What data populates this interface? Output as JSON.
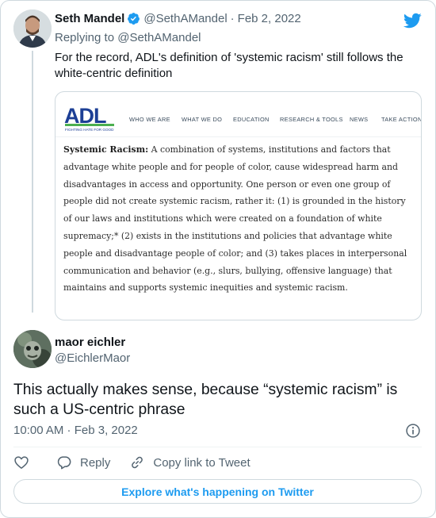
{
  "parent_tweet": {
    "author_name": "Seth Mandel",
    "handle": "@SethAMandel",
    "date": "Feb 2, 2022",
    "replying_to": "Replying to @SethAMandel",
    "text": "For the record, ADL's definition of 'systemic racism' still follows the white-centric definition"
  },
  "embedded_image": {
    "logo_text": "ADL",
    "logo_tagline": "FIGHTING HATE FOR GOOD",
    "nav": [
      "WHO WE ARE",
      "WHAT WE DO",
      "EDUCATION",
      "RESEARCH & TOOLS",
      "NEWS",
      "TAKE ACTION"
    ],
    "term": "Systemic Racism:",
    "definition": "A combination of systems, institutions and factors that advantage white people and for people of color, cause widespread harm and disadvantages in access and opportunity. One person or even one group of people did not create systemic racism, rather it: (1) is grounded in the history of our laws and institutions which were created on a foundation of white supremacy;* (2) exists in the institutions and policies that advantage white people and disadvantage people of color; and (3) takes places in interpersonal communication and behavior (e.g., slurs, bullying, offensive language) that maintains and supports systemic inequities and systemic racism."
  },
  "reply_tweet": {
    "author_name": "maor eichler",
    "handle": "@EichlerMaor",
    "text": "This actually makes sense, because “systemic racism” is such a US-centric phrase",
    "timestamp": "10:00 AM · Feb 3, 2022"
  },
  "actions": {
    "reply_label": "Reply",
    "copy_label": "Copy link to Tweet"
  },
  "explore_label": "Explore what's happening on Twitter",
  "colors": {
    "twitter_blue": "#1d9bf0",
    "secondary_text": "#536471",
    "border": "#cfd9de",
    "adl_blue": "#1c3f95",
    "adl_green": "#4caf50"
  },
  "icons": [
    "verified-badge-icon",
    "twitter-bird-icon",
    "info-icon",
    "heart-icon",
    "reply-icon",
    "link-icon"
  ]
}
